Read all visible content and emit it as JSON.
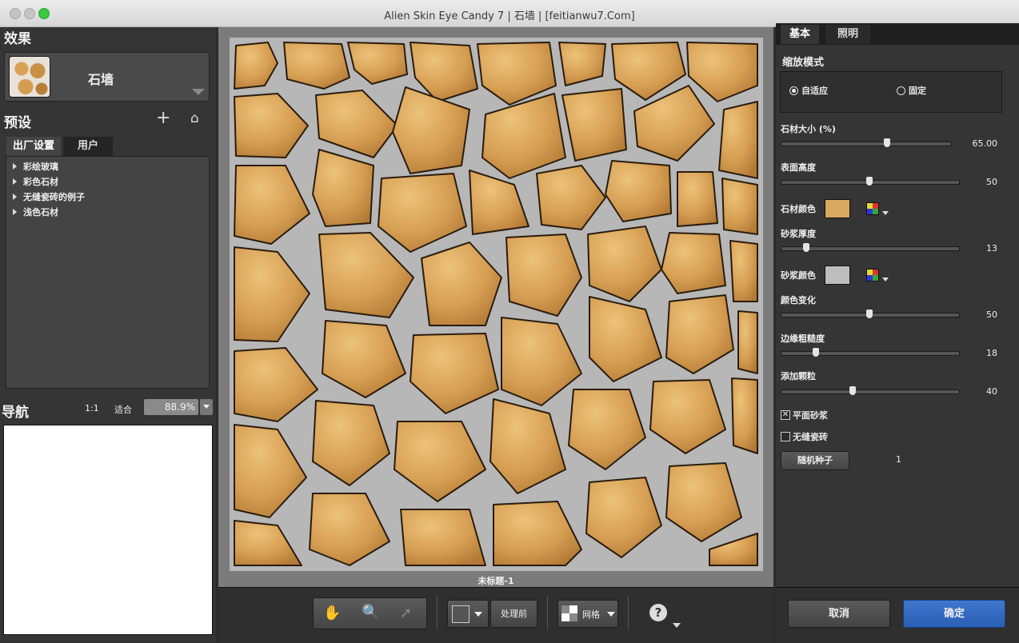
{
  "window": {
    "title": "Alien Skin Eye Candy 7 | 石墙 | [feitianwu7.Com]"
  },
  "left": {
    "effect_title": "效果",
    "effect_name": "石墙",
    "presets_title": "预设",
    "tabs": [
      "出厂设置",
      "用户"
    ],
    "preset_items": [
      "彩绘玻璃",
      "彩色石材",
      "无缝瓷砖的例子",
      "浅色石材"
    ],
    "nav_title": "导航",
    "zoom_1to1": "1:1",
    "zoom_fit": "适合",
    "zoom_value": "88.9%"
  },
  "canvas": {
    "doc_name": "未标题-1"
  },
  "toolbar": {
    "before_label": "处理前",
    "grid_label": "网格",
    "help": "?"
  },
  "right": {
    "tabs": [
      "基本",
      "照明"
    ],
    "zoom_mode_title": "缩放模式",
    "mode_adaptive": "自适应",
    "mode_fixed": "固定",
    "sliders": [
      {
        "label": "石材大小 (%)",
        "value": "65.00",
        "level": 0.63
      },
      {
        "label": "表面高度",
        "value": "50",
        "level": 0.5
      },
      {
        "label": "砂浆厚度",
        "value": "13",
        "level": 0.13
      },
      {
        "label": "颜色变化",
        "value": "50",
        "level": 0.5
      },
      {
        "label": "边缘粗糙度",
        "value": "18",
        "level": 0.18
      },
      {
        "label": "添加颗粒",
        "value": "40",
        "level": 0.4
      }
    ],
    "stone_color_label": "石材颜色",
    "stone_color": "#d9a85f",
    "mortar_color_label": "砂浆颜色",
    "mortar_color": "#bdbdbd",
    "flat_mortar_label": "平面砂浆",
    "flat_mortar_checked": true,
    "seamless_label": "无缝瓷砖",
    "seamless_checked": false,
    "random_seed_button": "随机种子",
    "random_seed_value": "1",
    "cancel": "取消",
    "ok": "确定"
  }
}
